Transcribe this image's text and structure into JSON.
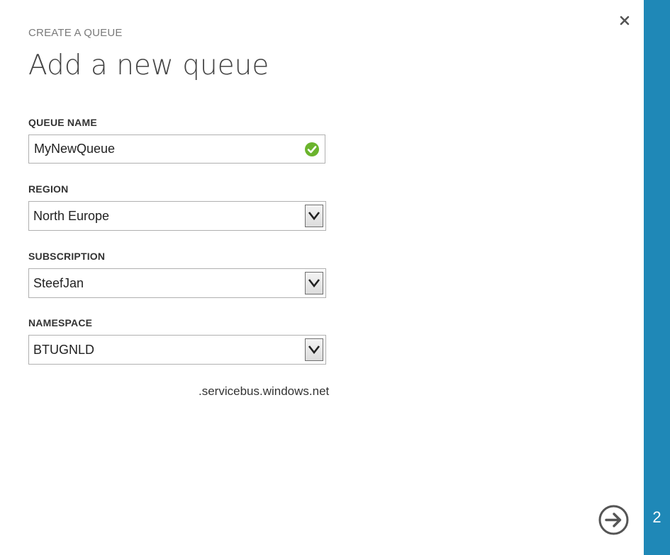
{
  "dialog": {
    "eyebrow": "CREATE A QUEUE",
    "title": "Add a new queue",
    "step_number": "2",
    "close_icon": "close-icon",
    "next_icon": "arrow-right-circle-icon"
  },
  "form": {
    "queue_name": {
      "label": "QUEUE NAME",
      "value": "MyNewQueue",
      "status_icon": "checkmark-circle-icon",
      "status_color": "#6bb42d"
    },
    "region": {
      "label": "REGION",
      "value": "North Europe"
    },
    "subscription": {
      "label": "SUBSCRIPTION",
      "value": "SteefJan"
    },
    "namespace": {
      "label": "NAMESPACE",
      "value": "BTUGNLD",
      "suffix": ".servicebus.windows.net"
    }
  },
  "colors": {
    "accent": "#1f88b7",
    "text_primary": "#222222",
    "text_muted": "#7a7a7a",
    "border": "#b0b0b0",
    "valid": "#6bb42d"
  }
}
